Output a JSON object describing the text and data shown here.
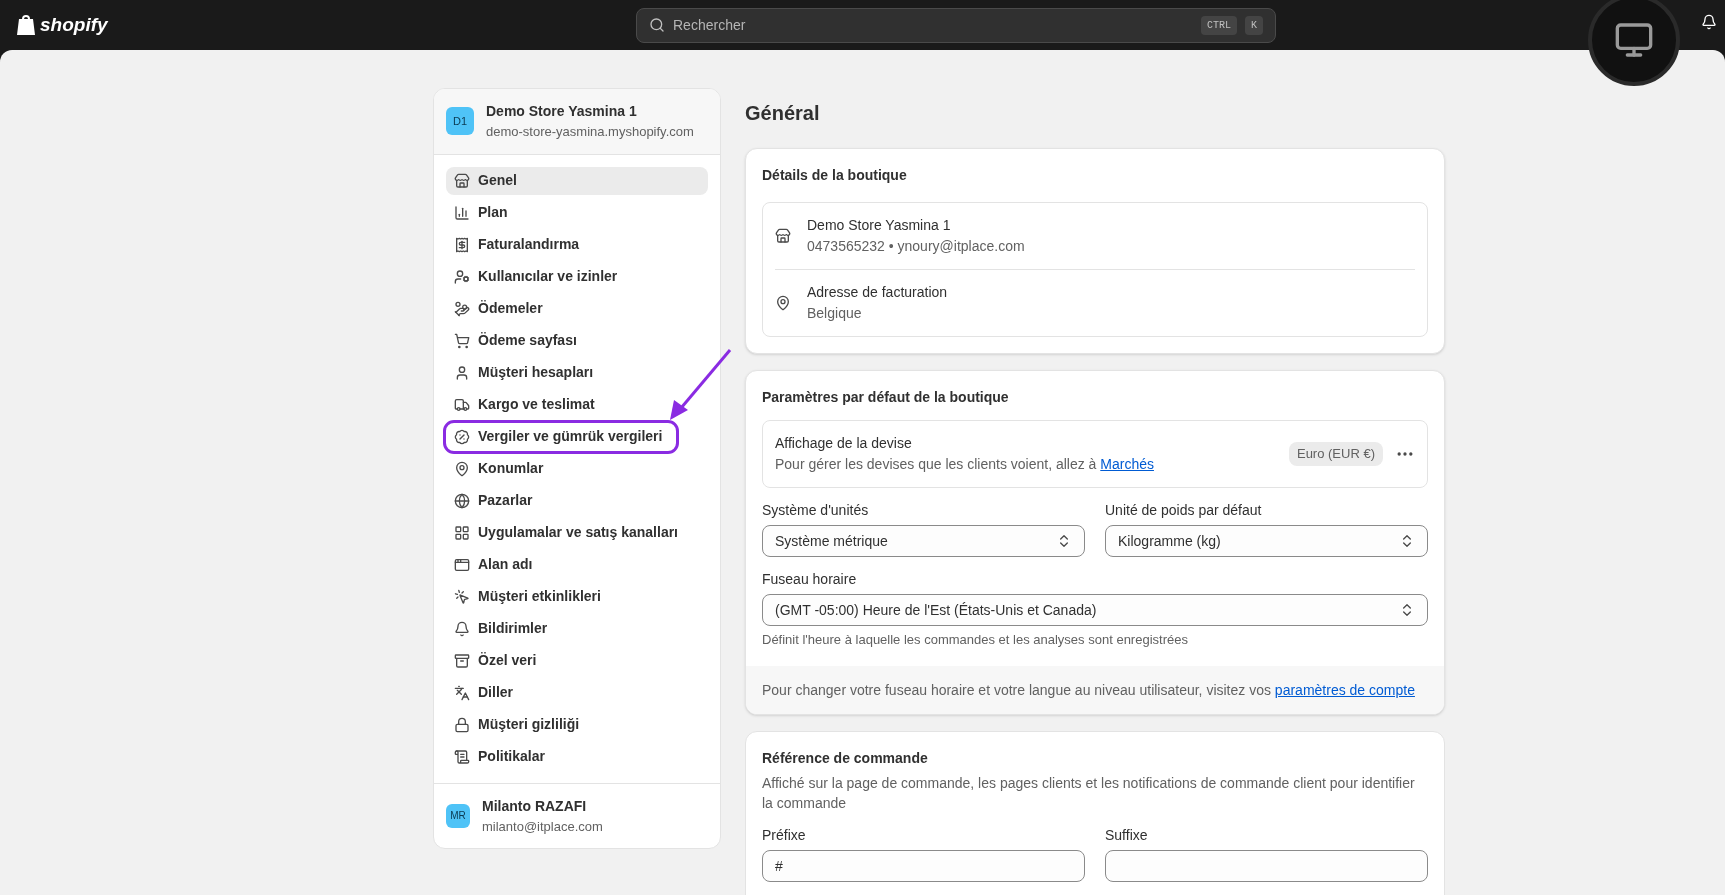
{
  "topbar": {
    "brand": "shopify",
    "search": {
      "placeholder": "Rechercher",
      "keys": [
        "CTRL",
        "K"
      ]
    }
  },
  "sidebar": {
    "store": {
      "initials": "D1",
      "name": "Demo Store Yasmina 1",
      "domain": "demo-store-yasmina.myshopify.com"
    },
    "items": [
      {
        "label": "Genel",
        "selected": true,
        "annotated": false
      },
      {
        "label": "Plan",
        "selected": false,
        "annotated": false
      },
      {
        "label": "Faturalandırma",
        "selected": false,
        "annotated": false
      },
      {
        "label": "Kullanıcılar ve izinler",
        "selected": false,
        "annotated": false
      },
      {
        "label": "Ödemeler",
        "selected": false,
        "annotated": false
      },
      {
        "label": "Ödeme sayfası",
        "selected": false,
        "annotated": false
      },
      {
        "label": "Müşteri hesapları",
        "selected": false,
        "annotated": false
      },
      {
        "label": "Kargo ve teslimat",
        "selected": false,
        "annotated": false
      },
      {
        "label": "Vergiler ve gümrük vergileri",
        "selected": false,
        "annotated": true
      },
      {
        "label": "Konumlar",
        "selected": false,
        "annotated": false
      },
      {
        "label": "Pazarlar",
        "selected": false,
        "annotated": false
      },
      {
        "label": "Uygulamalar ve satış kanalları",
        "selected": false,
        "annotated": false
      },
      {
        "label": "Alan adı",
        "selected": false,
        "annotated": false
      },
      {
        "label": "Müşteri etkinlikleri",
        "selected": false,
        "annotated": false
      },
      {
        "label": "Bildirimler",
        "selected": false,
        "annotated": false
      },
      {
        "label": "Özel veri",
        "selected": false,
        "annotated": false
      },
      {
        "label": "Diller",
        "selected": false,
        "annotated": false
      },
      {
        "label": "Müşteri gizliliği",
        "selected": false,
        "annotated": false
      },
      {
        "label": "Politikalar",
        "selected": false,
        "annotated": false
      }
    ],
    "user": {
      "initials": "MR",
      "name": "Milanto RAZAFI",
      "email": "milanto@itplace.com"
    }
  },
  "main": {
    "title": "Général",
    "store_details": {
      "title": "Détails de la boutique",
      "rows": [
        {
          "title": "Demo Store Yasmina 1",
          "detail": "0473565232 • ynoury@itplace.com"
        },
        {
          "title": "Adresse de facturation",
          "detail": "Belgique"
        }
      ]
    },
    "defaults": {
      "title": "Paramètres par défaut de la boutique",
      "currency": {
        "title": "Affichage de la devise",
        "text": "Pour gérer les devises que les clients voient, allez à ",
        "link": "Marchés",
        "badge": "Euro (EUR €)"
      },
      "unit_system": {
        "label": "Système d'unités",
        "value": "Système métrique"
      },
      "weight_unit": {
        "label": "Unité de poids par défaut",
        "value": "Kilogramme (kg)"
      },
      "timezone": {
        "label": "Fuseau horaire",
        "value": "(GMT -05:00) Heure de l'Est (États-Unis et Canada)",
        "help": "Définit l'heure à laquelle les commandes et les analyses sont enregistrées"
      },
      "footer": {
        "text": "Pour changer votre fuseau horaire et votre langue au niveau utilisateur, visitez vos ",
        "link": "paramètres de compte"
      }
    },
    "order_ref": {
      "title": "Référence de commande",
      "text": "Affiché sur la page de commande, les pages clients et les notifications de commande client pour identifier la commande",
      "prefix": {
        "label": "Préfixe",
        "value": "#"
      },
      "suffix": {
        "label": "Suffixe"
      }
    }
  }
}
